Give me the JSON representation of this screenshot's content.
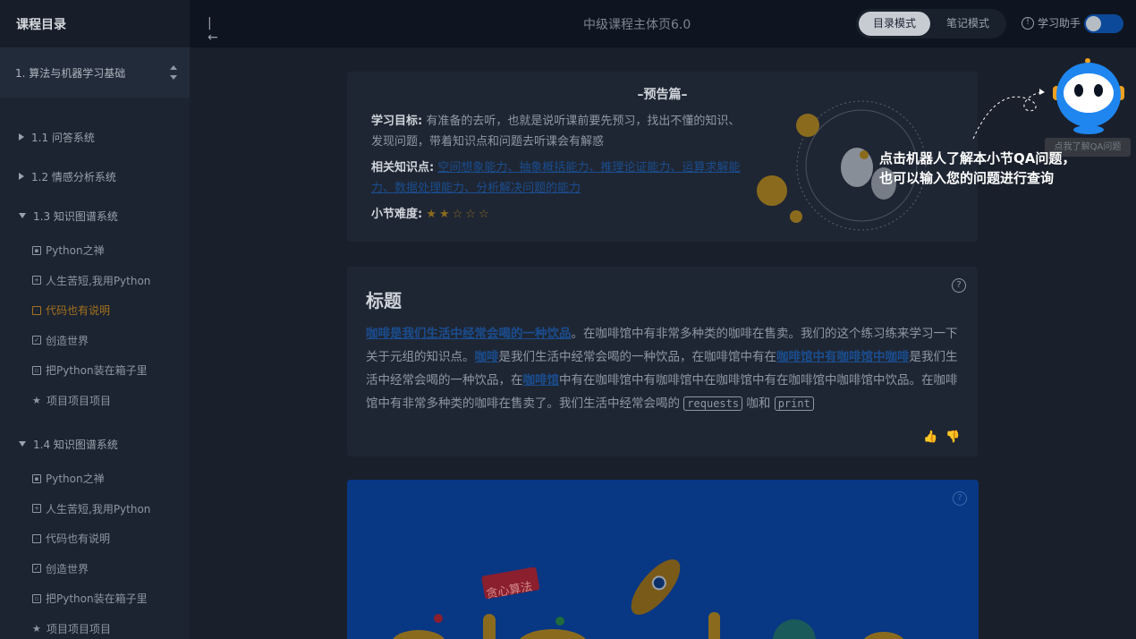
{
  "sidebar": {
    "title": "课程目录",
    "course": "1. 算法与机器学习基础",
    "sections": [
      {
        "label": "1.1 问答系统",
        "expanded": false
      },
      {
        "label": "1.2 情感分析系统",
        "expanded": false
      },
      {
        "label": "1.3 知识图谱系统",
        "expanded": true,
        "items": [
          {
            "label": "Python之禅"
          },
          {
            "label": "人生苦短,我用Python"
          },
          {
            "label": "代码也有说明",
            "active": true
          },
          {
            "label": "创造世界"
          },
          {
            "label": "把Python装在箱子里"
          },
          {
            "label": "项目项目项目"
          }
        ]
      },
      {
        "label": "1.4 知识图谱系统",
        "expanded": true,
        "items": [
          {
            "label": "Python之禅"
          },
          {
            "label": "人生苦短,我用Python"
          },
          {
            "label": "代码也有说明"
          },
          {
            "label": "创造世界"
          },
          {
            "label": "把Python装在箱子里"
          },
          {
            "label": "项目项目项目"
          }
        ]
      }
    ]
  },
  "topbar": {
    "page_title": "中级课程主体页6.0",
    "mode_catalog": "目录模式",
    "mode_notes": "笔记模式",
    "assistant_label": "学习助手"
  },
  "preview": {
    "title": "–预告篇–",
    "goal_label": "学习目标:",
    "goal_text": "有准备的去听，也就是说听课前要先预习，找出不懂的知识、发现问题，带着知识点和问题去听课会有解惑",
    "knowledge_label": "相关知识点:",
    "knowledge_links": [
      "空间想象能力",
      "抽象概括能力",
      "推理论证能力",
      "运算求解能力",
      "数据处理能力",
      "分析解决问题的能力"
    ],
    "difficulty_label": "小节难度:",
    "difficulty_stars": "★★☆☆☆",
    "difficulty_value": 2
  },
  "content": {
    "title": "标题",
    "link1": "咖啡是我们生活中经常会喝的一种饮品",
    "text1": "。在咖啡馆中有非常多种类的咖啡在售卖。我们的这个练习练来学习一下关于元组的知识点。",
    "link2": "咖啡",
    "text2": "是我们生活中经常会喝的一种饮品，在咖啡馆中有在",
    "link3": "咖啡馆中有咖啡馆中咖啡",
    "text3": "是我们生活中经常会喝的一种饮品，在",
    "link4": "咖啡馆",
    "text4": "中有在咖啡馆中有咖啡馆中在咖啡馆中有在咖啡馆中咖啡馆中饮品。在咖啡馆中有非常多种类的咖啡在售卖了。我们生活中经常会喝的",
    "code1": "requests",
    "text5": "咖和",
    "code2": "print"
  },
  "banner": {
    "badge": "贪心算法"
  },
  "assistant_overlay": {
    "tooltip": "点我了解QA问题",
    "hint_line1": "点击机器人了解本小节QA问题，",
    "hint_line2": "也可以输入您的问题进行查询"
  },
  "colors": {
    "accent_blue": "#1a4d8f",
    "active_orange": "#a5711d",
    "banner_blue": "#083784",
    "robot_blue": "#1f86f0"
  }
}
